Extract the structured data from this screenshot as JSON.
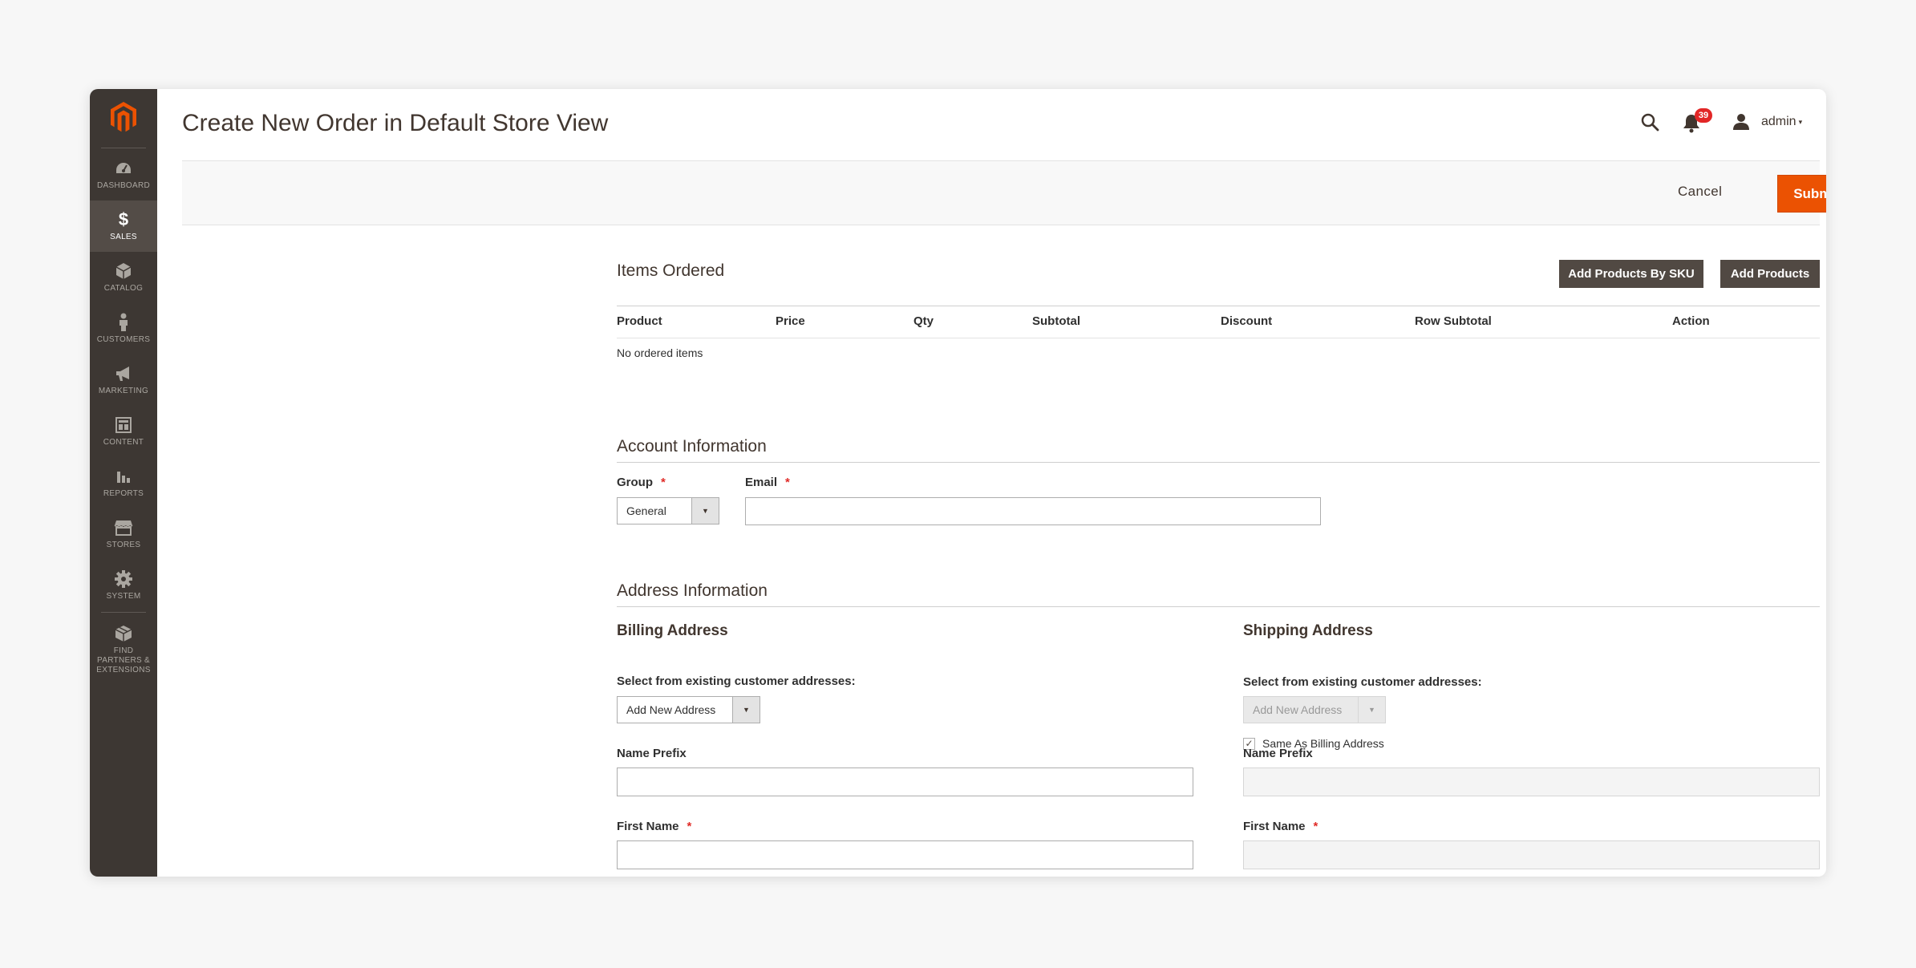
{
  "page": {
    "title": "Create New Order in Default Store View"
  },
  "sidebar": {
    "items": [
      {
        "label": "Dashboard",
        "icon": "dashboard-icon"
      },
      {
        "label": "Sales",
        "icon": "dollar-icon",
        "active": true
      },
      {
        "label": "Catalog",
        "icon": "cube-icon"
      },
      {
        "label": "Customers",
        "icon": "person-icon"
      },
      {
        "label": "Marketing",
        "icon": "megaphone-icon"
      },
      {
        "label": "Content",
        "icon": "layout-icon"
      },
      {
        "label": "Reports",
        "icon": "bar-chart-icon"
      },
      {
        "label": "Stores",
        "icon": "storefront-icon"
      },
      {
        "label": "System",
        "icon": "gear-icon"
      },
      {
        "label": "Find Partners & Extensions",
        "icon": "box-icon"
      }
    ]
  },
  "header": {
    "notifications_count": "39",
    "user_name": "admin"
  },
  "actions": {
    "cancel_label": "Cancel",
    "submit_label": "Submit Order"
  },
  "items_ordered": {
    "title": "Items Ordered",
    "add_by_sku_label": "Add Products By SKU",
    "add_products_label": "Add Products",
    "columns": [
      "Product",
      "Price",
      "Qty",
      "Subtotal",
      "Discount",
      "Row Subtotal",
      "Action"
    ],
    "empty_text": "No ordered items"
  },
  "account_info": {
    "title": "Account Information",
    "group_label": "Group",
    "group_value": "General",
    "email_label": "Email",
    "email_value": ""
  },
  "address_info": {
    "title": "Address Information",
    "billing": {
      "title": "Billing Address",
      "select_label": "Select from existing customer addresses:",
      "select_value": "Add New Address",
      "name_prefix_label": "Name Prefix",
      "first_name_label": "First Name"
    },
    "shipping": {
      "title": "Shipping Address",
      "same_as_billing_label": "Same As Billing Address",
      "same_as_billing_checked": true,
      "select_label": "Select from existing customer addresses:",
      "select_value": "Add New Address",
      "name_prefix_label": "Name Prefix",
      "first_name_label": "First Name"
    }
  },
  "colors": {
    "accent": "#eb5202",
    "sidebar_bg": "#3d3733",
    "dark_button": "#514943",
    "required": "#e02b27"
  }
}
